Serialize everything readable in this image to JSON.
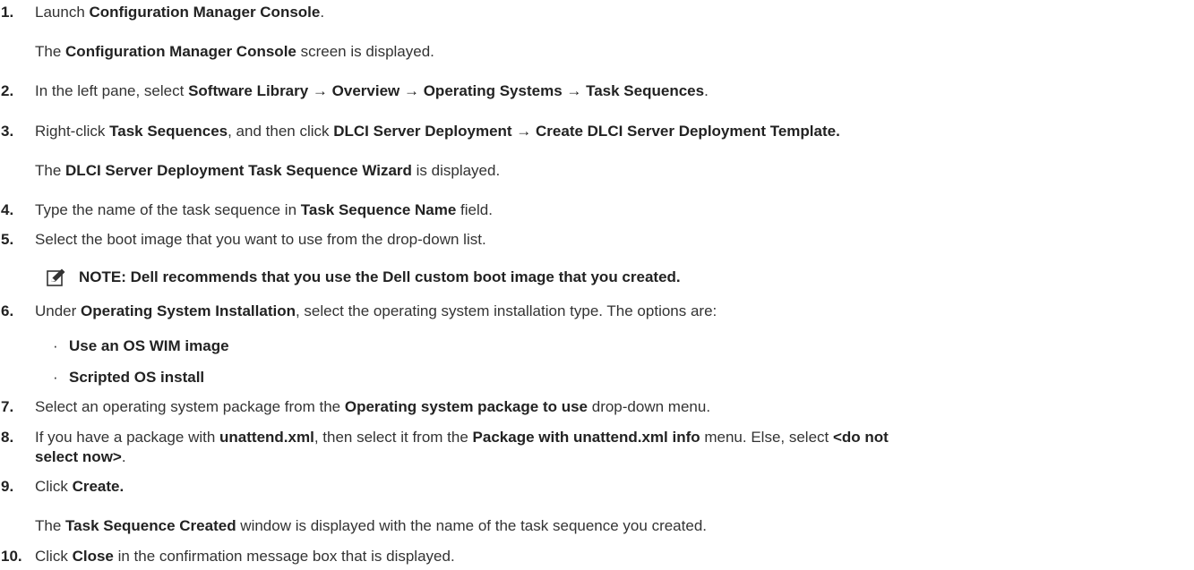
{
  "steps": [
    {
      "num": "1.",
      "a": "Launch ",
      "b": "Configuration Manager Console",
      "c": "."
    },
    {
      "sub_a": "The ",
      "sub_b": "Configuration Manager Console",
      "sub_c": " screen is displayed."
    },
    {
      "num": "2.",
      "a": "In the left pane, select ",
      "b": "Software Library → Overview → Operating Systems → Task Sequences",
      "c": "."
    },
    {
      "num": "3.",
      "a": "Right-click ",
      "b": "Task Sequences",
      "c": ", and then click ",
      "d": "DLCI Server Deployment → Create DLCI Server Deployment Template."
    },
    {
      "sub_a": "The ",
      "sub_b": "DLCI Server Deployment Task Sequence Wizard",
      "sub_c": " is displayed."
    },
    {
      "num": "4.",
      "a": "Type the name of the task sequence in ",
      "b": "Task Sequence Name",
      "c": " field."
    },
    {
      "num": "5.",
      "a": "Select the boot image that you want to use from the drop-down list."
    },
    {
      "note": "NOTE: Dell recommends that you use the Dell custom boot image that you created."
    },
    {
      "num": "6.",
      "a": "Under ",
      "b": "Operating System Installation",
      "c": ", select the operating system installation type. The options are:"
    },
    {
      "bullet": "Use an OS WIM image"
    },
    {
      "bullet": "Scripted OS install"
    },
    {
      "num": "7.",
      "a": "Select an operating system package from the ",
      "b": "Operating system package to use",
      "c": " drop-down menu."
    },
    {
      "num": "8.",
      "a": "If you have a package with ",
      "b": "unattend.xml",
      "c": ", then select it from the ",
      "d": "Package with unattend.xml info",
      "e": " menu. Else, select ",
      "f": "<do not"
    },
    {
      "cont_b": "select now>",
      "cont_c": "."
    },
    {
      "num": "9.",
      "a": "Click ",
      "b": "Create."
    },
    {
      "sub_a": "The ",
      "sub_b": "Task Sequence Created",
      "sub_c": " window is displayed with the name of the task sequence you created."
    },
    {
      "num": "10.",
      "a": "Click ",
      "b": "Close",
      "c": " in the confirmation message box that is displayed."
    }
  ],
  "icons": {
    "note": "pencil-note-icon"
  }
}
